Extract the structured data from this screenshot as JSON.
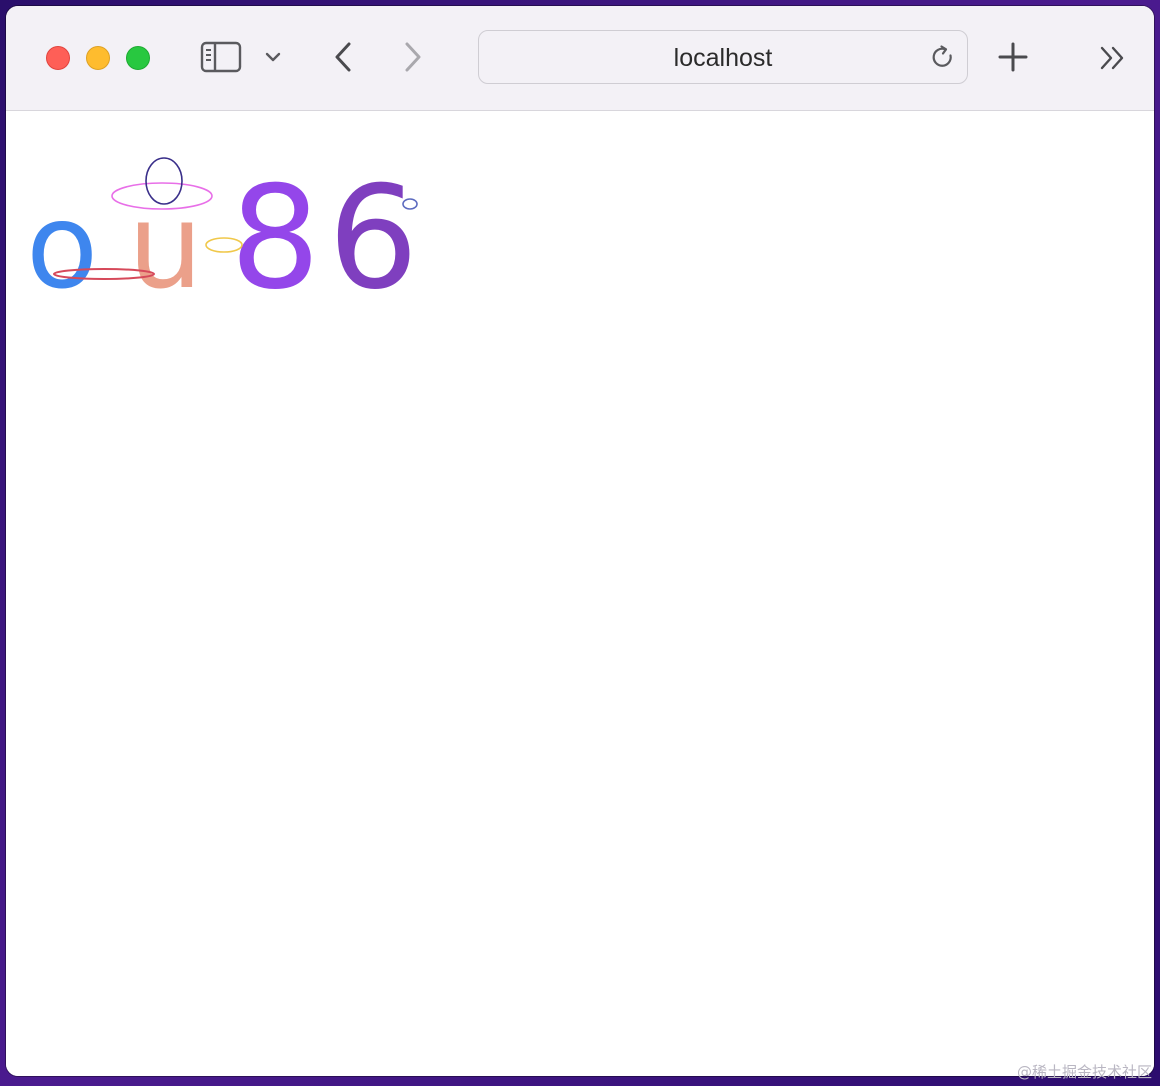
{
  "browser": {
    "address": "localhost",
    "icons": {
      "sidebar": "sidebar-icon",
      "tab_overview": "chevron-down-icon",
      "back": "back-icon",
      "forward": "forward-icon",
      "reload": "reload-icon",
      "new_tab": "plus-icon",
      "more": "double-chevron-right-icon"
    }
  },
  "captcha": {
    "characters": [
      {
        "char": "o",
        "color": "#3e86ee"
      },
      {
        "char": "u",
        "color": "#eba08a"
      },
      {
        "char": "8",
        "color": "#9446ea"
      },
      {
        "char": "6",
        "color": "#7f3fbf"
      }
    ],
    "noise_colors": [
      "#d6495a",
      "#e86fe8",
      "#3a2f8a",
      "#f0c84a",
      "#5d6bbf"
    ]
  },
  "watermark": "@稀土掘金技术社区"
}
